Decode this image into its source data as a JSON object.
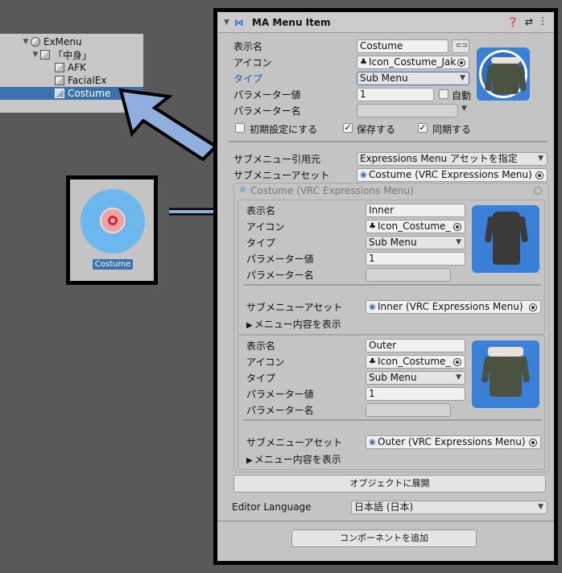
{
  "hierarchy": {
    "root": "ExMenu",
    "child": "「中身」",
    "items": [
      "AFK",
      "FacialEx",
      "Costume"
    ]
  },
  "preview": {
    "label": "Costume"
  },
  "inspector": {
    "title": "MA Menu Item",
    "labels": {
      "display_name": "表示名",
      "icon": "アイコン",
      "type": "タイプ",
      "param_value": "パラメーター値",
      "param_name": "パラメーター名",
      "initial": "初期設定にする",
      "saved": "保存する",
      "synced": "同期する",
      "auto": "自動",
      "submenu_source": "サブメニュー引用元",
      "submenu_asset": "サブメニューアセット",
      "show_contents": "メニュー内容を表示",
      "expand": "オブジェクトに展開",
      "editor_language": "Editor Language",
      "add_component": "コンポーネントを追加"
    },
    "values": {
      "display_name": "Costume",
      "icon": "Icon_Costume_Jak",
      "type": "Sub Menu",
      "param_value": "1",
      "param_name": "",
      "submenu_source": "Expressions Menu アセットを指定",
      "submenu_asset": "Costume (VRC Expressions Menu)",
      "language": "日本語 (日本)"
    },
    "submenu_header": "Costume (VRC Expressions Menu)",
    "entries": [
      {
        "display_name": "Inner",
        "icon": "Icon_Costume_",
        "type": "Sub Menu",
        "param_value": "1",
        "param_name": "",
        "asset": "Inner (VRC Expressions Menu)"
      },
      {
        "display_name": "Outer",
        "icon": "Icon_Costume_",
        "type": "Sub Menu",
        "param_value": "1",
        "param_name": "",
        "asset": "Outer (VRC Expressions Menu)"
      }
    ]
  }
}
